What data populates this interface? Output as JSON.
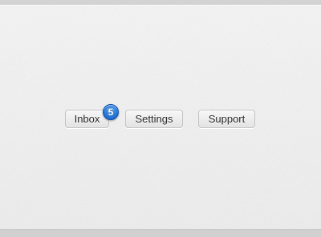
{
  "nav": {
    "inbox_label": "Inbox",
    "inbox_badge_count": "5",
    "settings_label": "Settings",
    "support_label": "Support"
  },
  "colors": {
    "badge": "#2b78d8",
    "background": "#efefef",
    "button_border": "#c4c4c4"
  }
}
